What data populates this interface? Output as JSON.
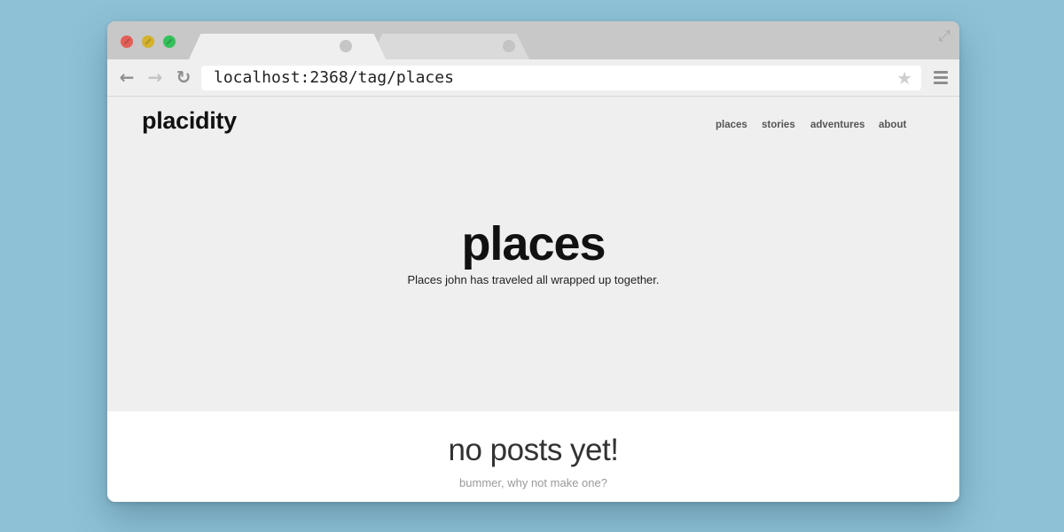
{
  "browser": {
    "url": "localhost:2368/tag/places",
    "icons": {
      "back": "back-arrow-icon",
      "forward": "forward-arrow-icon",
      "reload": "reload-icon",
      "bookmark": "star-icon",
      "menu": "hamburger-menu-icon",
      "fullscreen": "expand-icon"
    },
    "glyphs": {
      "back": "←",
      "forward": "→",
      "reload": "↻",
      "star": "★",
      "fullscreen": "⤢"
    }
  },
  "site": {
    "title": "placidity",
    "nav": [
      "places",
      "stories",
      "adventures",
      "about"
    ]
  },
  "hero": {
    "tag_title": "places",
    "tag_description": "Places john has traveled all wrapped up together."
  },
  "empty_state": {
    "title": "no posts yet!",
    "subtitle": "bummer, why not make one?"
  },
  "colors": {
    "background": "#8ec1d6",
    "close": "#e45f57",
    "minimize": "#d4b22c",
    "maximize": "#35c15a"
  }
}
